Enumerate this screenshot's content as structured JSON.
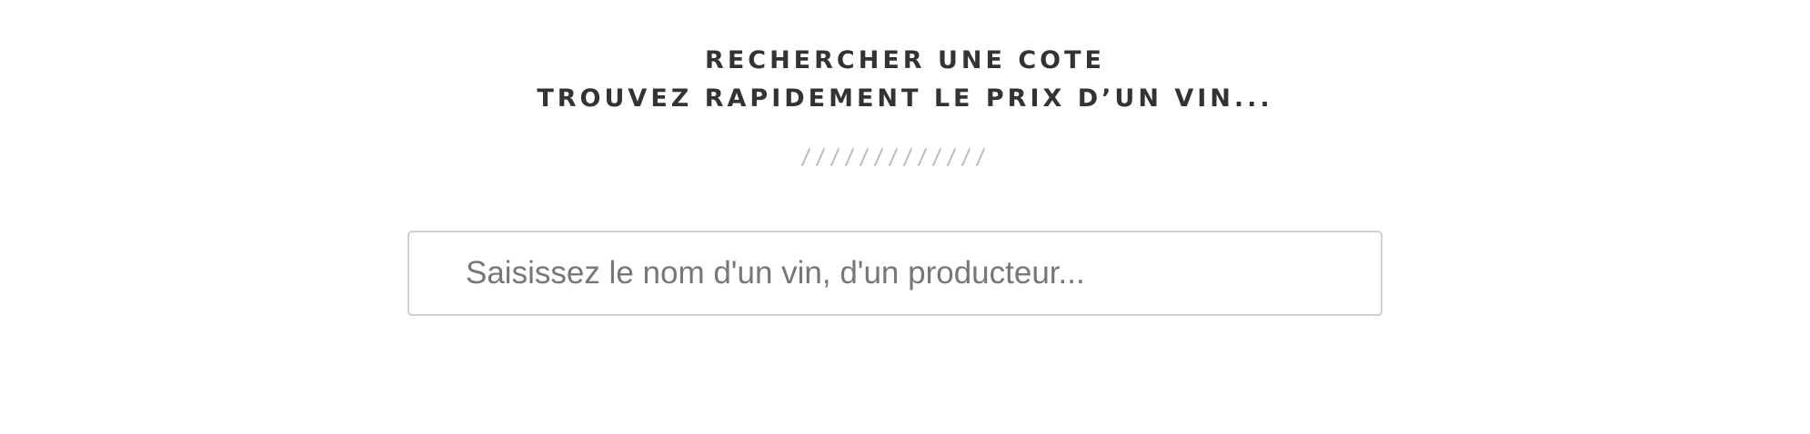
{
  "header": {
    "title_line1": "RECHERCHER UNE COTE",
    "title_line2": "TROUVEZ RAPIDEMENT LE PRIX D’UN VIN..."
  },
  "divider": {
    "icon": "diagonal-lines-divider",
    "color": "#bdbdbd"
  },
  "search": {
    "placeholder": "Saisissez le nom d'un vin, d'un producteur...",
    "value": ""
  },
  "colors": {
    "heading": "#333333",
    "input_border": "#cfcfcf",
    "placeholder": "#777777",
    "background": "#ffffff"
  }
}
